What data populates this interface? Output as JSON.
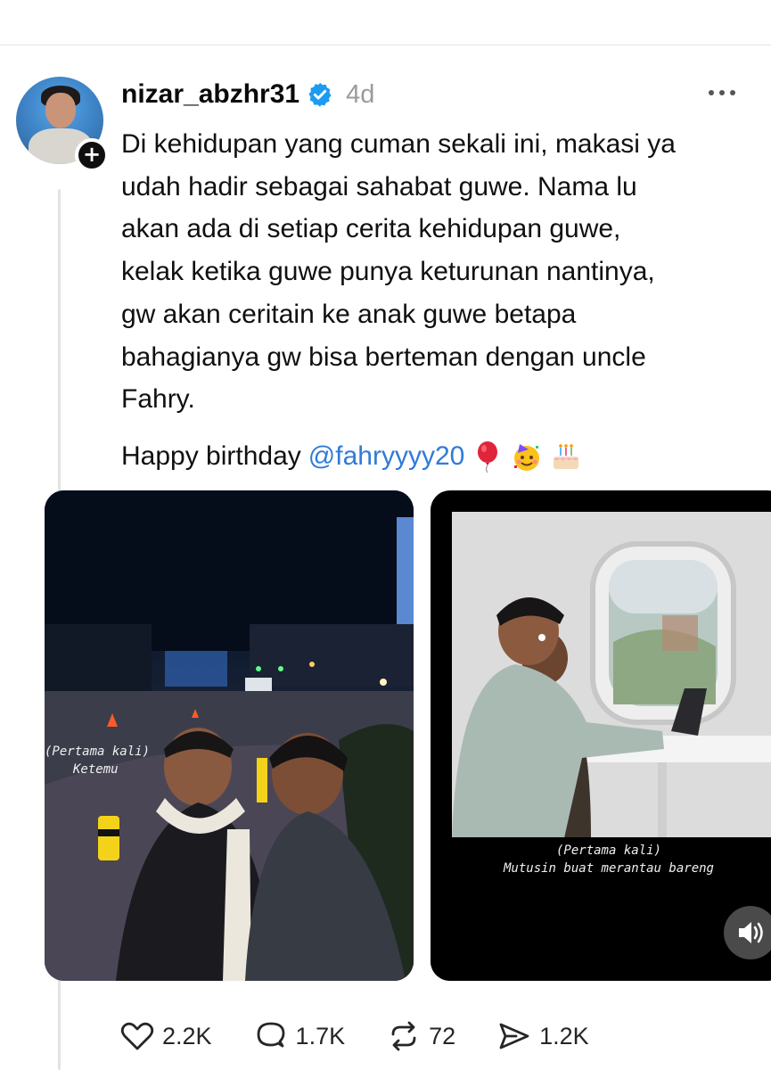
{
  "post": {
    "username": "nizar_abzhr31",
    "verified_icon": "verified-badge-icon",
    "time": "4d",
    "caption_lines": [
      "Di kehidupan yang cuman sekali ini, makasi ya",
      "udah hadir sebagai sahabat guwe. Nama lu",
      "akan ada di setiap cerita kehidupan guwe,",
      "kelak ketika guwe punya keturunan nantinya,",
      "gw akan ceritain ke anak guwe betapa",
      "bahagianya gw bisa berteman dengan uncle",
      "Fahry."
    ],
    "birthday_text": "Happy birthday",
    "mention": "@fahryyyy20",
    "emojis": [
      "balloon-icon",
      "party-face-icon",
      "birthday-cake-icon"
    ]
  },
  "media": [
    {
      "caption_lines": [
        "(Pertama kali)",
        "Ketemu"
      ]
    },
    {
      "caption_lines": [
        "(Pertama kali)",
        "Mutusin buat merantau bareng"
      ]
    }
  ],
  "actions": {
    "likes": "2.2K",
    "replies": "1.7K",
    "reposts": "72",
    "shares": "1.2K"
  },
  "colors": {
    "mention": "#2f7bd8",
    "verified": "#1d9bf0"
  }
}
